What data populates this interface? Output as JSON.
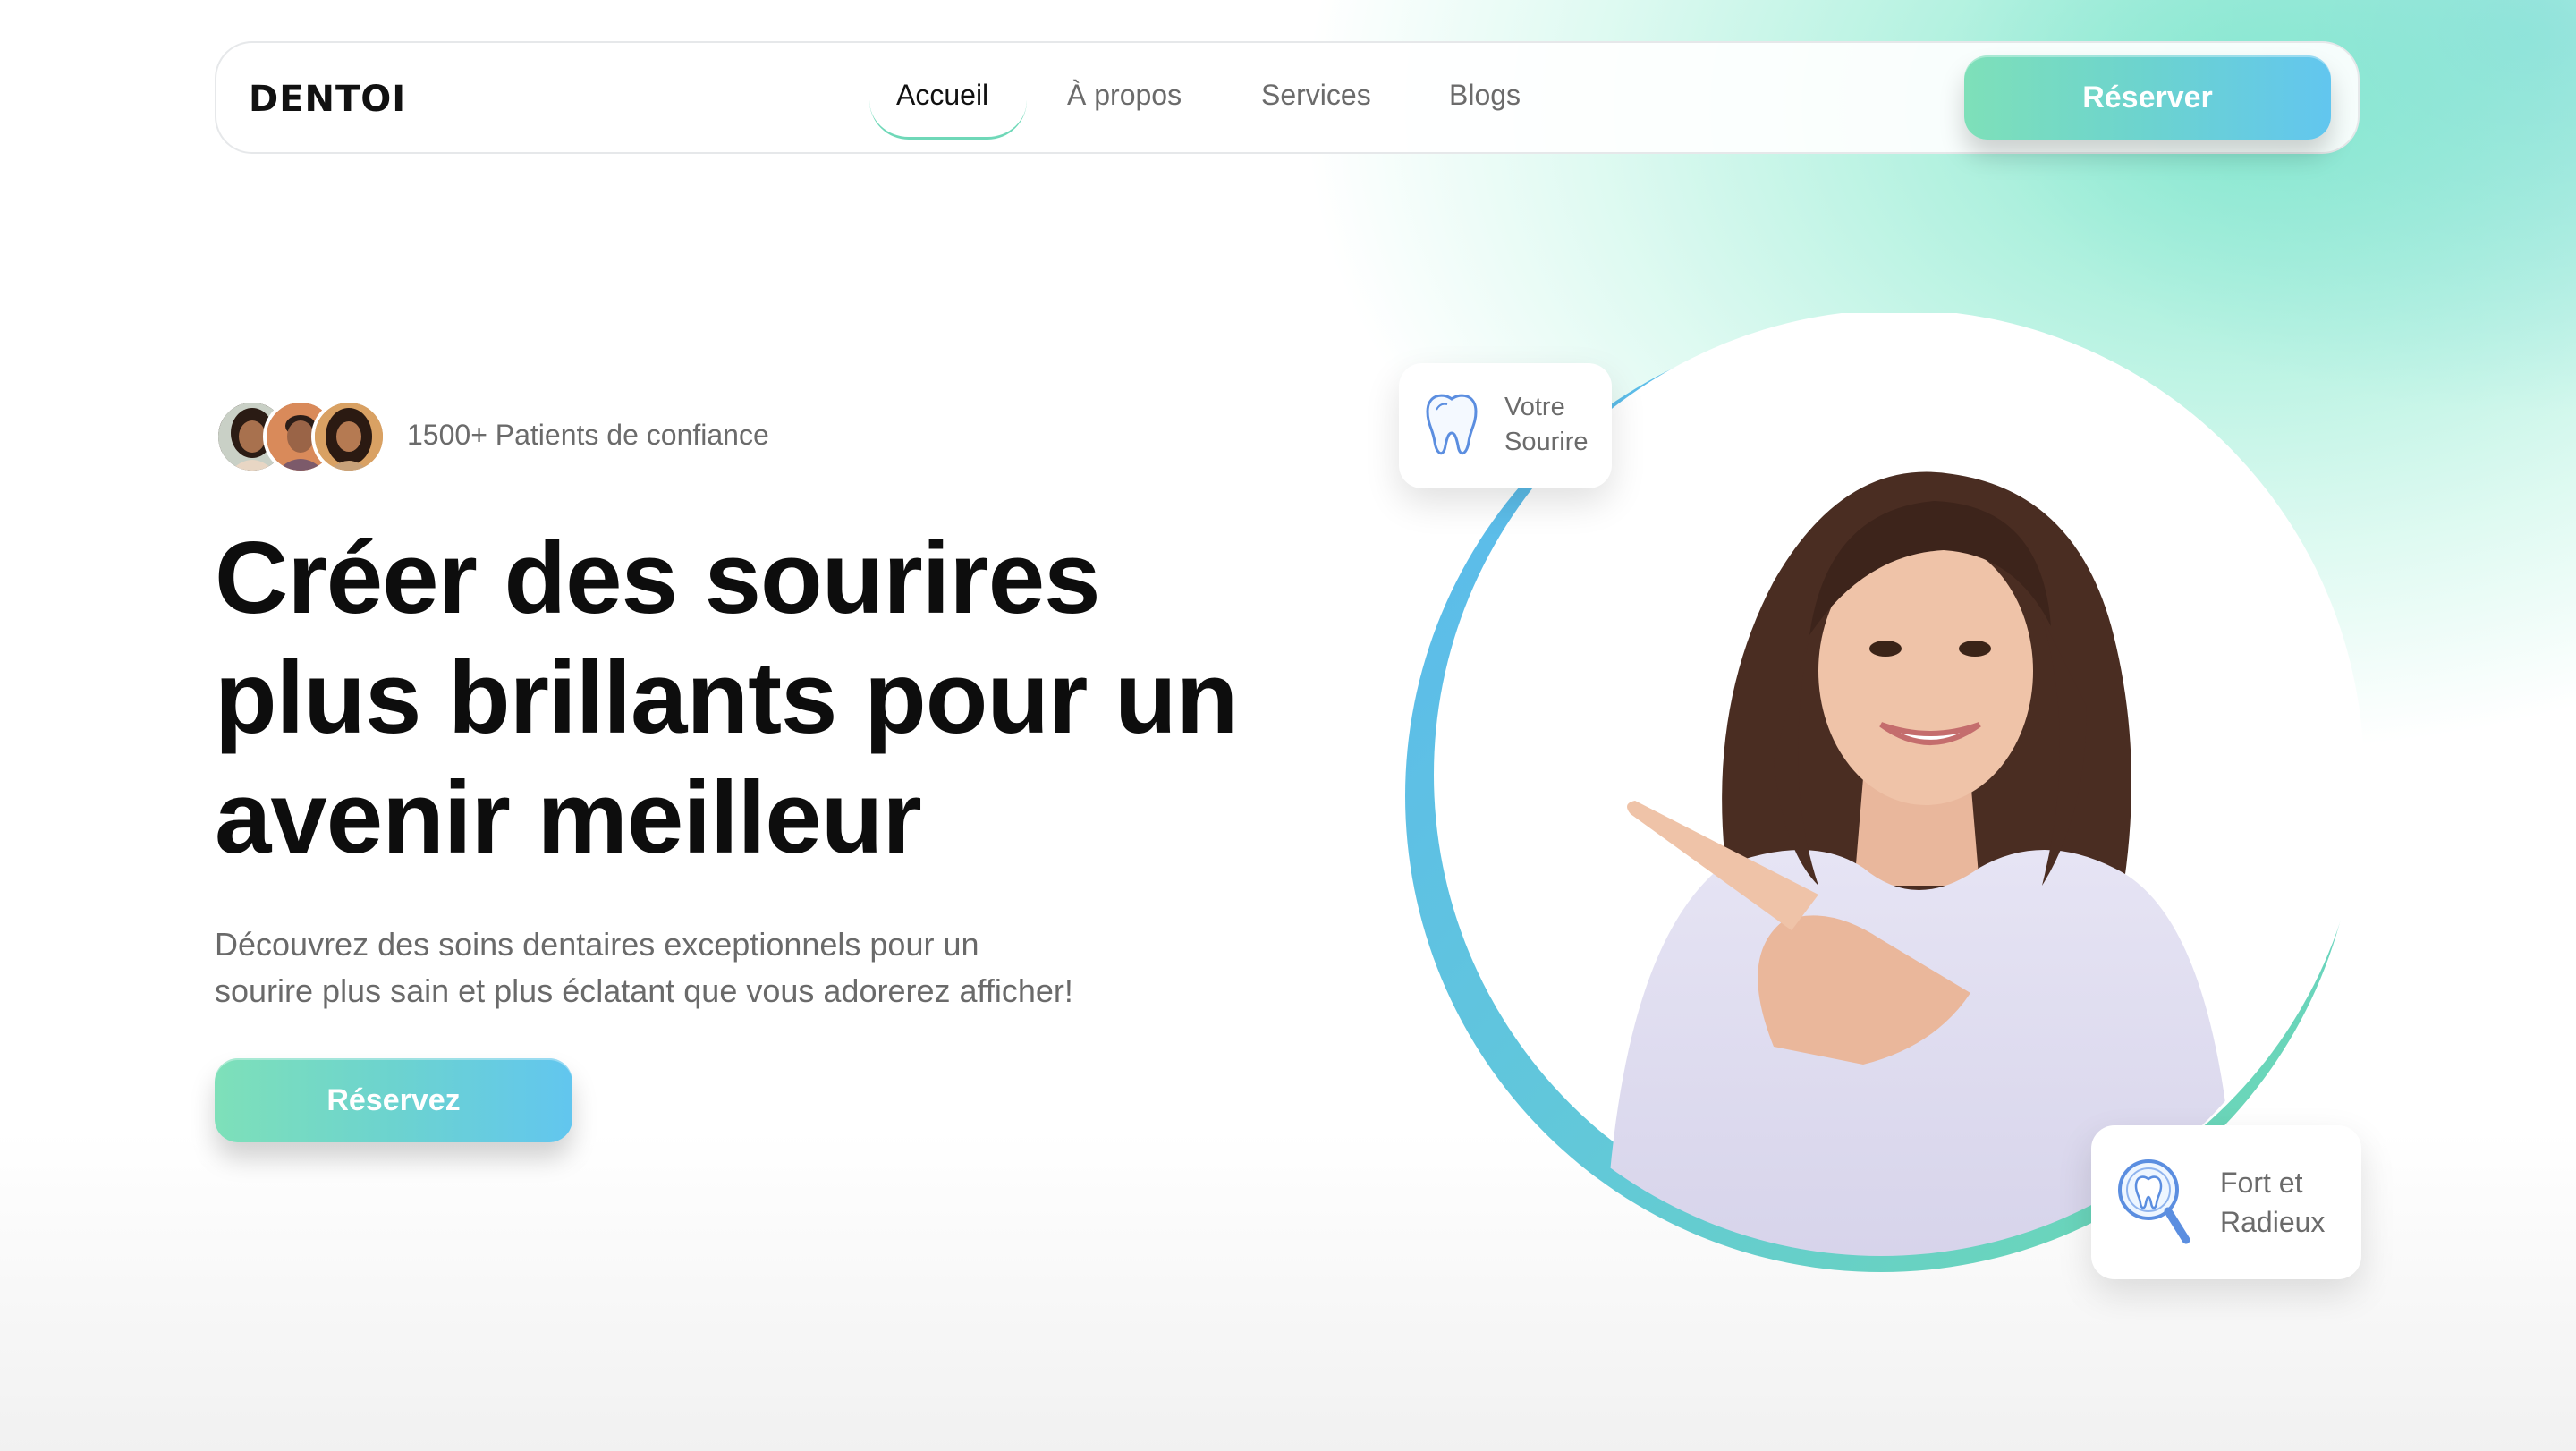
{
  "brand": {
    "logo_text": "DENTOI"
  },
  "nav": {
    "links": [
      {
        "label": "Accueil",
        "active": true
      },
      {
        "label": "À propos",
        "active": false
      },
      {
        "label": "Services",
        "active": false
      },
      {
        "label": "Blogs",
        "active": false
      }
    ],
    "cta_label": "Réserver"
  },
  "hero": {
    "patients_text": "1500+ Patients de confiance",
    "headline_lines": [
      "Créer des sourires",
      "plus brillants pour un",
      "avenir meilleur"
    ],
    "subtitle_lines": [
      "Découvrez des soins dentaires exceptionnels pour un",
      "sourire plus sain et plus éclatant que vous adorerez afficher!"
    ],
    "cta_label": "Réservez"
  },
  "cards": {
    "smile": {
      "icon": "tooth-icon",
      "lines": [
        "Votre",
        "Sourire"
      ]
    },
    "strong": {
      "icon": "tooth-magnifier-icon",
      "lines": [
        "Fort et",
        "Radieux"
      ]
    }
  },
  "colors": {
    "accent_green": "#7ee0b9",
    "accent_blue": "#62c6ef",
    "text_dark": "#0d0d0d",
    "text_muted": "#6b6b6b"
  }
}
